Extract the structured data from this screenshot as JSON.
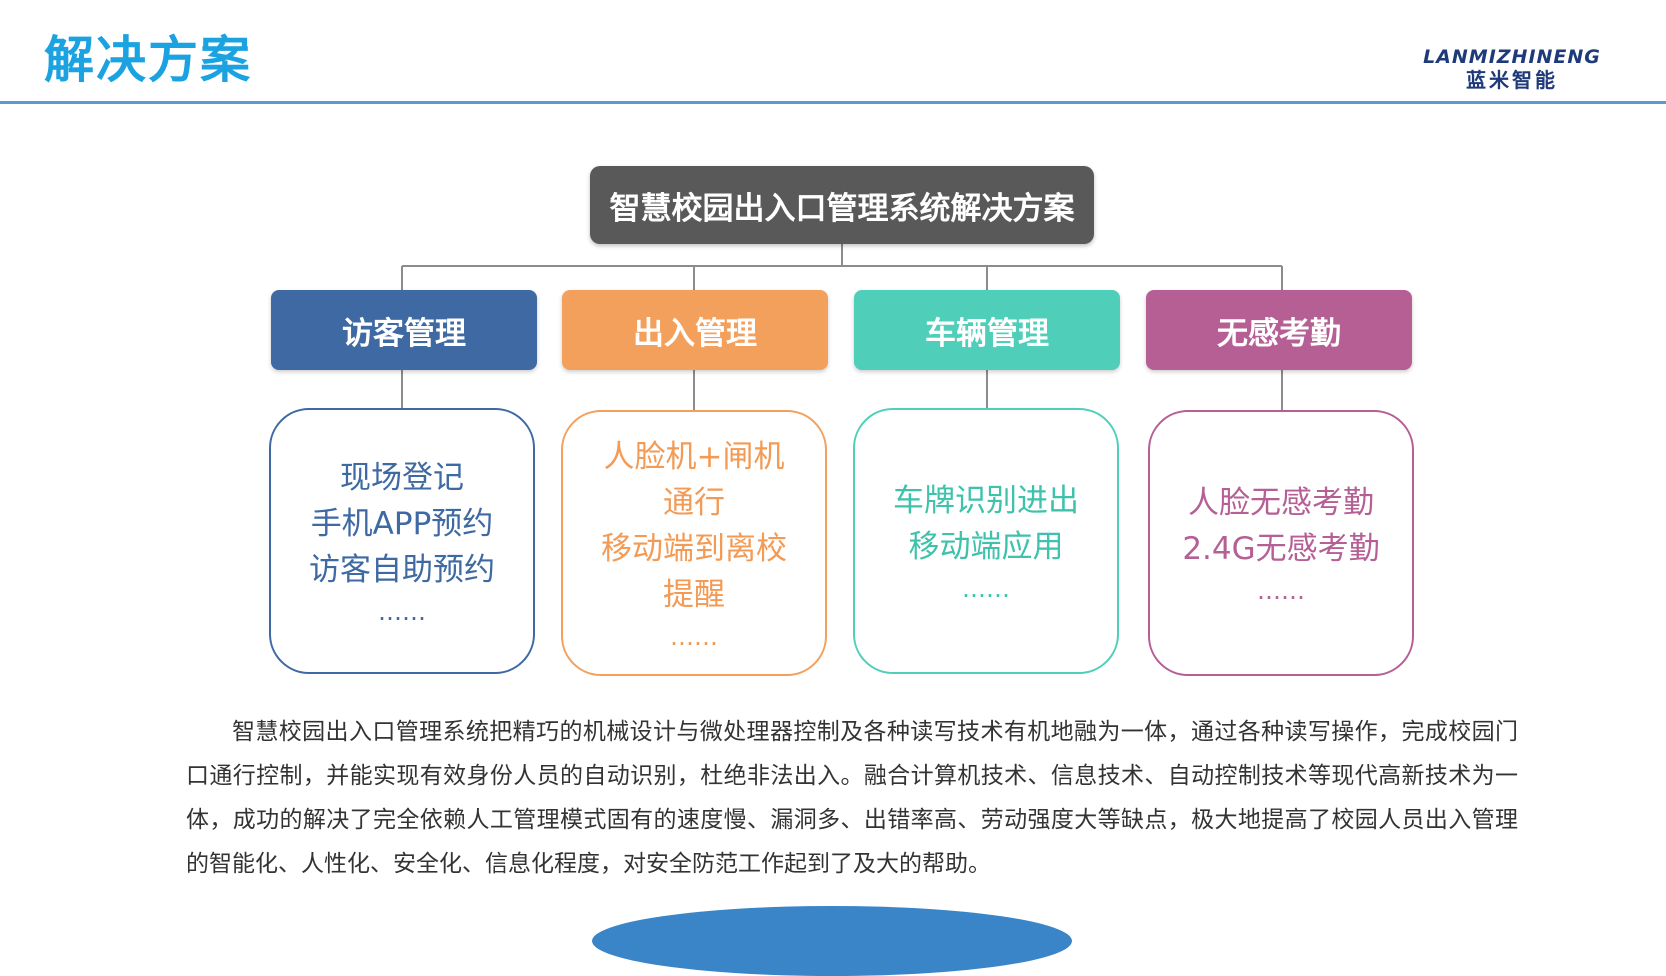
{
  "header": {
    "title": "解决方案",
    "logo_en": "LANMIZHINENG",
    "logo_cn": "蓝米智能"
  },
  "diagram": {
    "root": "智慧校园出入口管理系统解决方案",
    "branches": [
      {
        "label": "访客管理",
        "color": "#3e69a3",
        "items": [
          "现场登记",
          "手机APP预约",
          "访客自助预约"
        ],
        "ellipsis": "……"
      },
      {
        "label": "出入管理",
        "color": "#f4a05d",
        "items": [
          "人脸机+闸机",
          "通行",
          "移动端到离校",
          "提醒"
        ],
        "ellipsis": "……"
      },
      {
        "label": "车辆管理",
        "color": "#4fcfba",
        "items": [
          "车牌识别进出",
          "移动端应用"
        ],
        "ellipsis": "……"
      },
      {
        "label": "无感考勤",
        "color": "#b55f95",
        "items": [
          "人脸无感考勤",
          "2.4G无感考勤"
        ],
        "ellipsis": "……"
      }
    ]
  },
  "description": "智慧校园出入口管理系统把精巧的机械设计与微处理器控制及各种读写技术有机地融为一体，通过各种读写操作，完成校园门口通行控制，并能实现有效身份人员的自动识别，杜绝非法出入。融合计算机技术、信息技术、自动控制技术等现代高新技术为一体，成功的解决了完全依赖人工管理模式固有的速度慢、漏洞多、出错率高、劳动强度大等缺点，极大地提高了校园人员出入管理的智能化、人性化、安全化、信息化程度，对安全防范工作起到了及大的帮助。"
}
